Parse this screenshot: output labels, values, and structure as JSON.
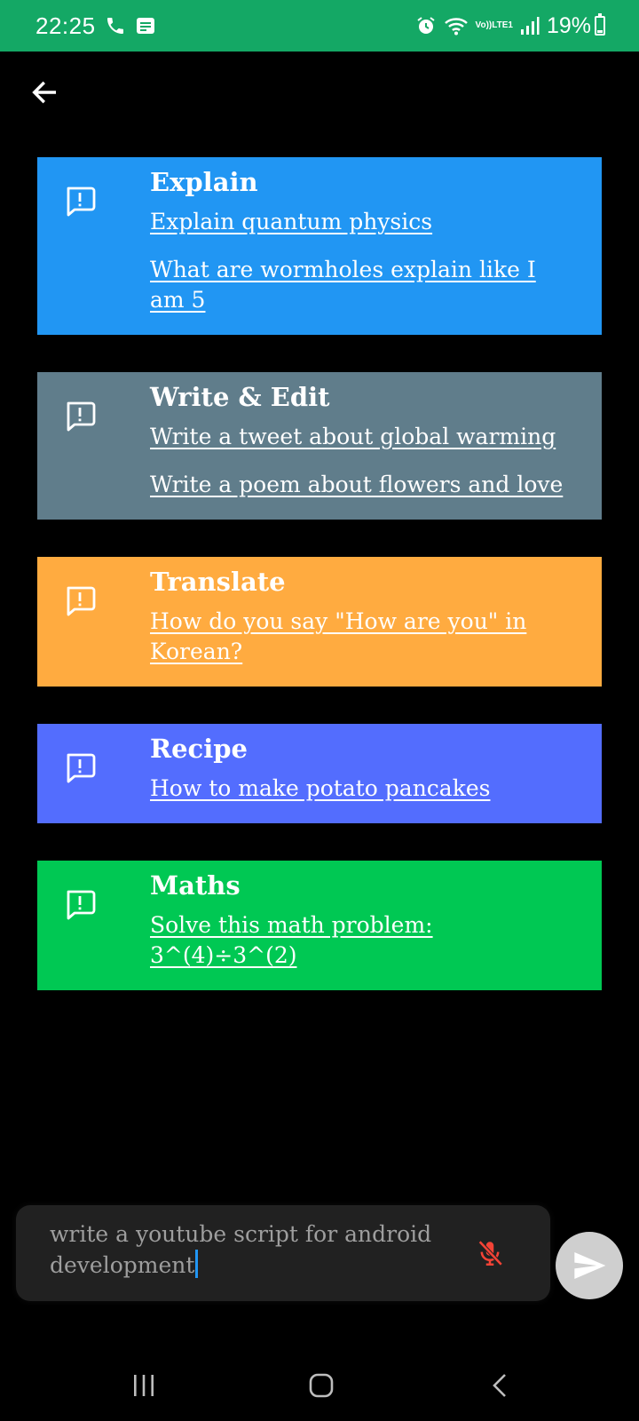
{
  "status_bar": {
    "time": "22:25",
    "lte_top": "Vo))",
    "lte_bottom": "LTE1",
    "battery": "19%",
    "battery_level": 0.19,
    "icons": [
      "phone-call-icon",
      "message-icon",
      "alarm-icon",
      "wifi-icon",
      "signal-icon",
      "battery-icon"
    ]
  },
  "header": {
    "back_icon": "arrow-left-icon"
  },
  "cards": [
    {
      "title": "Explain",
      "color": "#2196f3",
      "icon": "feedback-icon",
      "items": [
        "Explain quantum physics",
        "What are wormholes explain like I am 5"
      ]
    },
    {
      "title": "Write & Edit",
      "color": "#607d8b",
      "icon": "feedback-icon",
      "items": [
        "Write a tweet about global warming",
        "Write a poem about flowers and love"
      ]
    },
    {
      "title": "Translate",
      "color": "#ffab40",
      "icon": "feedback-icon",
      "items": [
        "How do you say \"How are you\" in Korean?"
      ]
    },
    {
      "title": "Recipe",
      "color": "#536dfe",
      "icon": "feedback-icon",
      "items": [
        "How to make potato pancakes"
      ]
    },
    {
      "title": "Maths",
      "color": "#00c853",
      "icon": "feedback-icon",
      "items": [
        "Solve this math problem: 3^(4)÷3^(2)"
      ]
    }
  ],
  "input": {
    "value": "write a youtube script for android development",
    "mic_icon": "mic-off-icon",
    "mic_color": "#f44336",
    "send_icon": "send-icon"
  },
  "nav_bar": {
    "icons": [
      "recent-apps-icon",
      "home-icon",
      "back-icon"
    ]
  }
}
